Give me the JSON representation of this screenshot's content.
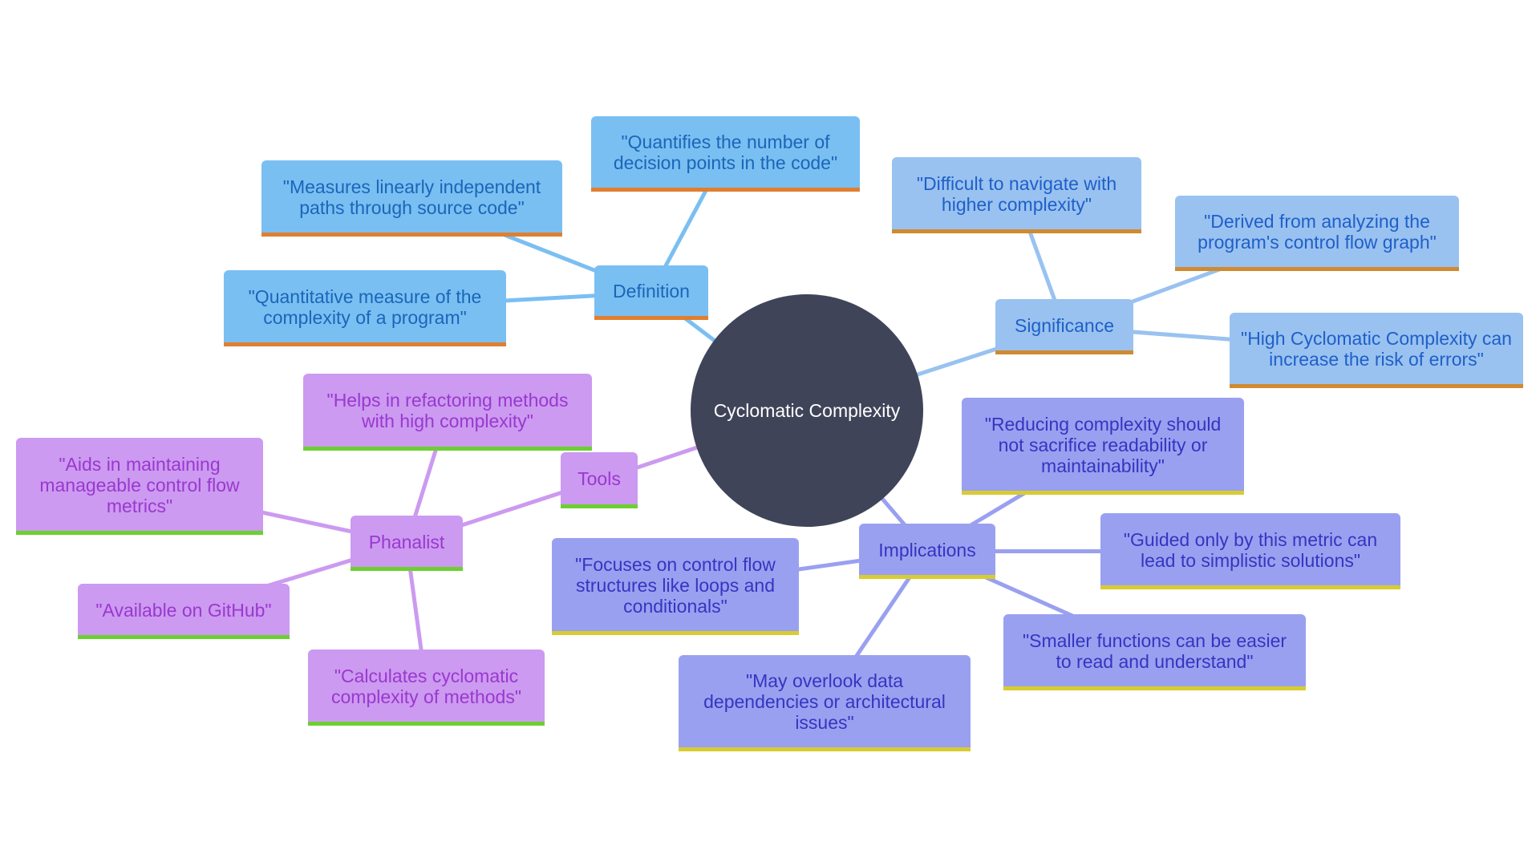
{
  "diagram": {
    "type": "mindmap",
    "root": {
      "id": "root",
      "label": "Cyclomatic Complexity"
    },
    "branches": [
      {
        "id": "definition",
        "label": "Definition",
        "theme": "def",
        "colors": {
          "fill": "#7abff2",
          "text": "#1a66b8",
          "accent": "#e07f30",
          "edge": "#7abff2"
        },
        "children": [
          {
            "id": "def-1",
            "label": "\"Quantifies the number of decision points in the code\""
          },
          {
            "id": "def-2",
            "label": "\"Measures linearly independent paths through source code\""
          },
          {
            "id": "def-3",
            "label": "\"Quantitative measure of the complexity of a program\""
          }
        ]
      },
      {
        "id": "significance",
        "label": "Significance",
        "theme": "sig",
        "colors": {
          "fill": "#99c2f0",
          "text": "#1f5fc8",
          "accent": "#d08a30",
          "edge": "#99c2f0"
        },
        "children": [
          {
            "id": "sig-1",
            "label": "\"Difficult to navigate with higher complexity\""
          },
          {
            "id": "sig-2",
            "label": "\"Derived from analyzing the program's control flow graph\""
          },
          {
            "id": "sig-3",
            "label": "\"High Cyclomatic Complexity can increase the risk of errors\""
          }
        ]
      },
      {
        "id": "implications",
        "label": "Implications",
        "theme": "imp",
        "colors": {
          "fill": "#9aa0f0",
          "text": "#3336c0",
          "accent": "#d8cc30",
          "edge": "#9aa0f0"
        },
        "children": [
          {
            "id": "imp-1",
            "label": "\"Reducing complexity should not sacrifice readability or maintainability\""
          },
          {
            "id": "imp-2",
            "label": "\"Guided only by this metric can lead to simplistic solutions\""
          },
          {
            "id": "imp-3",
            "label": "\"Smaller functions can be easier to read and understand\""
          },
          {
            "id": "imp-4",
            "label": "\"May overlook data dependencies or architectural issues\""
          },
          {
            "id": "imp-5",
            "label": "\"Focuses on control flow structures like loops and conditionals\""
          }
        ]
      },
      {
        "id": "tools",
        "label": "Tools",
        "theme": "tool",
        "colors": {
          "fill": "#cc9af0",
          "text": "#9a38d0",
          "accent": "#6cd030",
          "edge": "#cc9af0"
        },
        "children": [
          {
            "id": "phanalist",
            "label": "Phanalist",
            "children": [
              {
                "id": "ph-1",
                "label": "\"Helps in refactoring methods with high complexity\""
              },
              {
                "id": "ph-2",
                "label": "\"Aids in maintaining manageable control flow metrics\""
              },
              {
                "id": "ph-3",
                "label": "\"Available on GitHub\""
              },
              {
                "id": "ph-4",
                "label": "\"Calculates cyclomatic complexity of methods\""
              }
            ]
          }
        ]
      }
    ],
    "root_color": "#404459"
  }
}
